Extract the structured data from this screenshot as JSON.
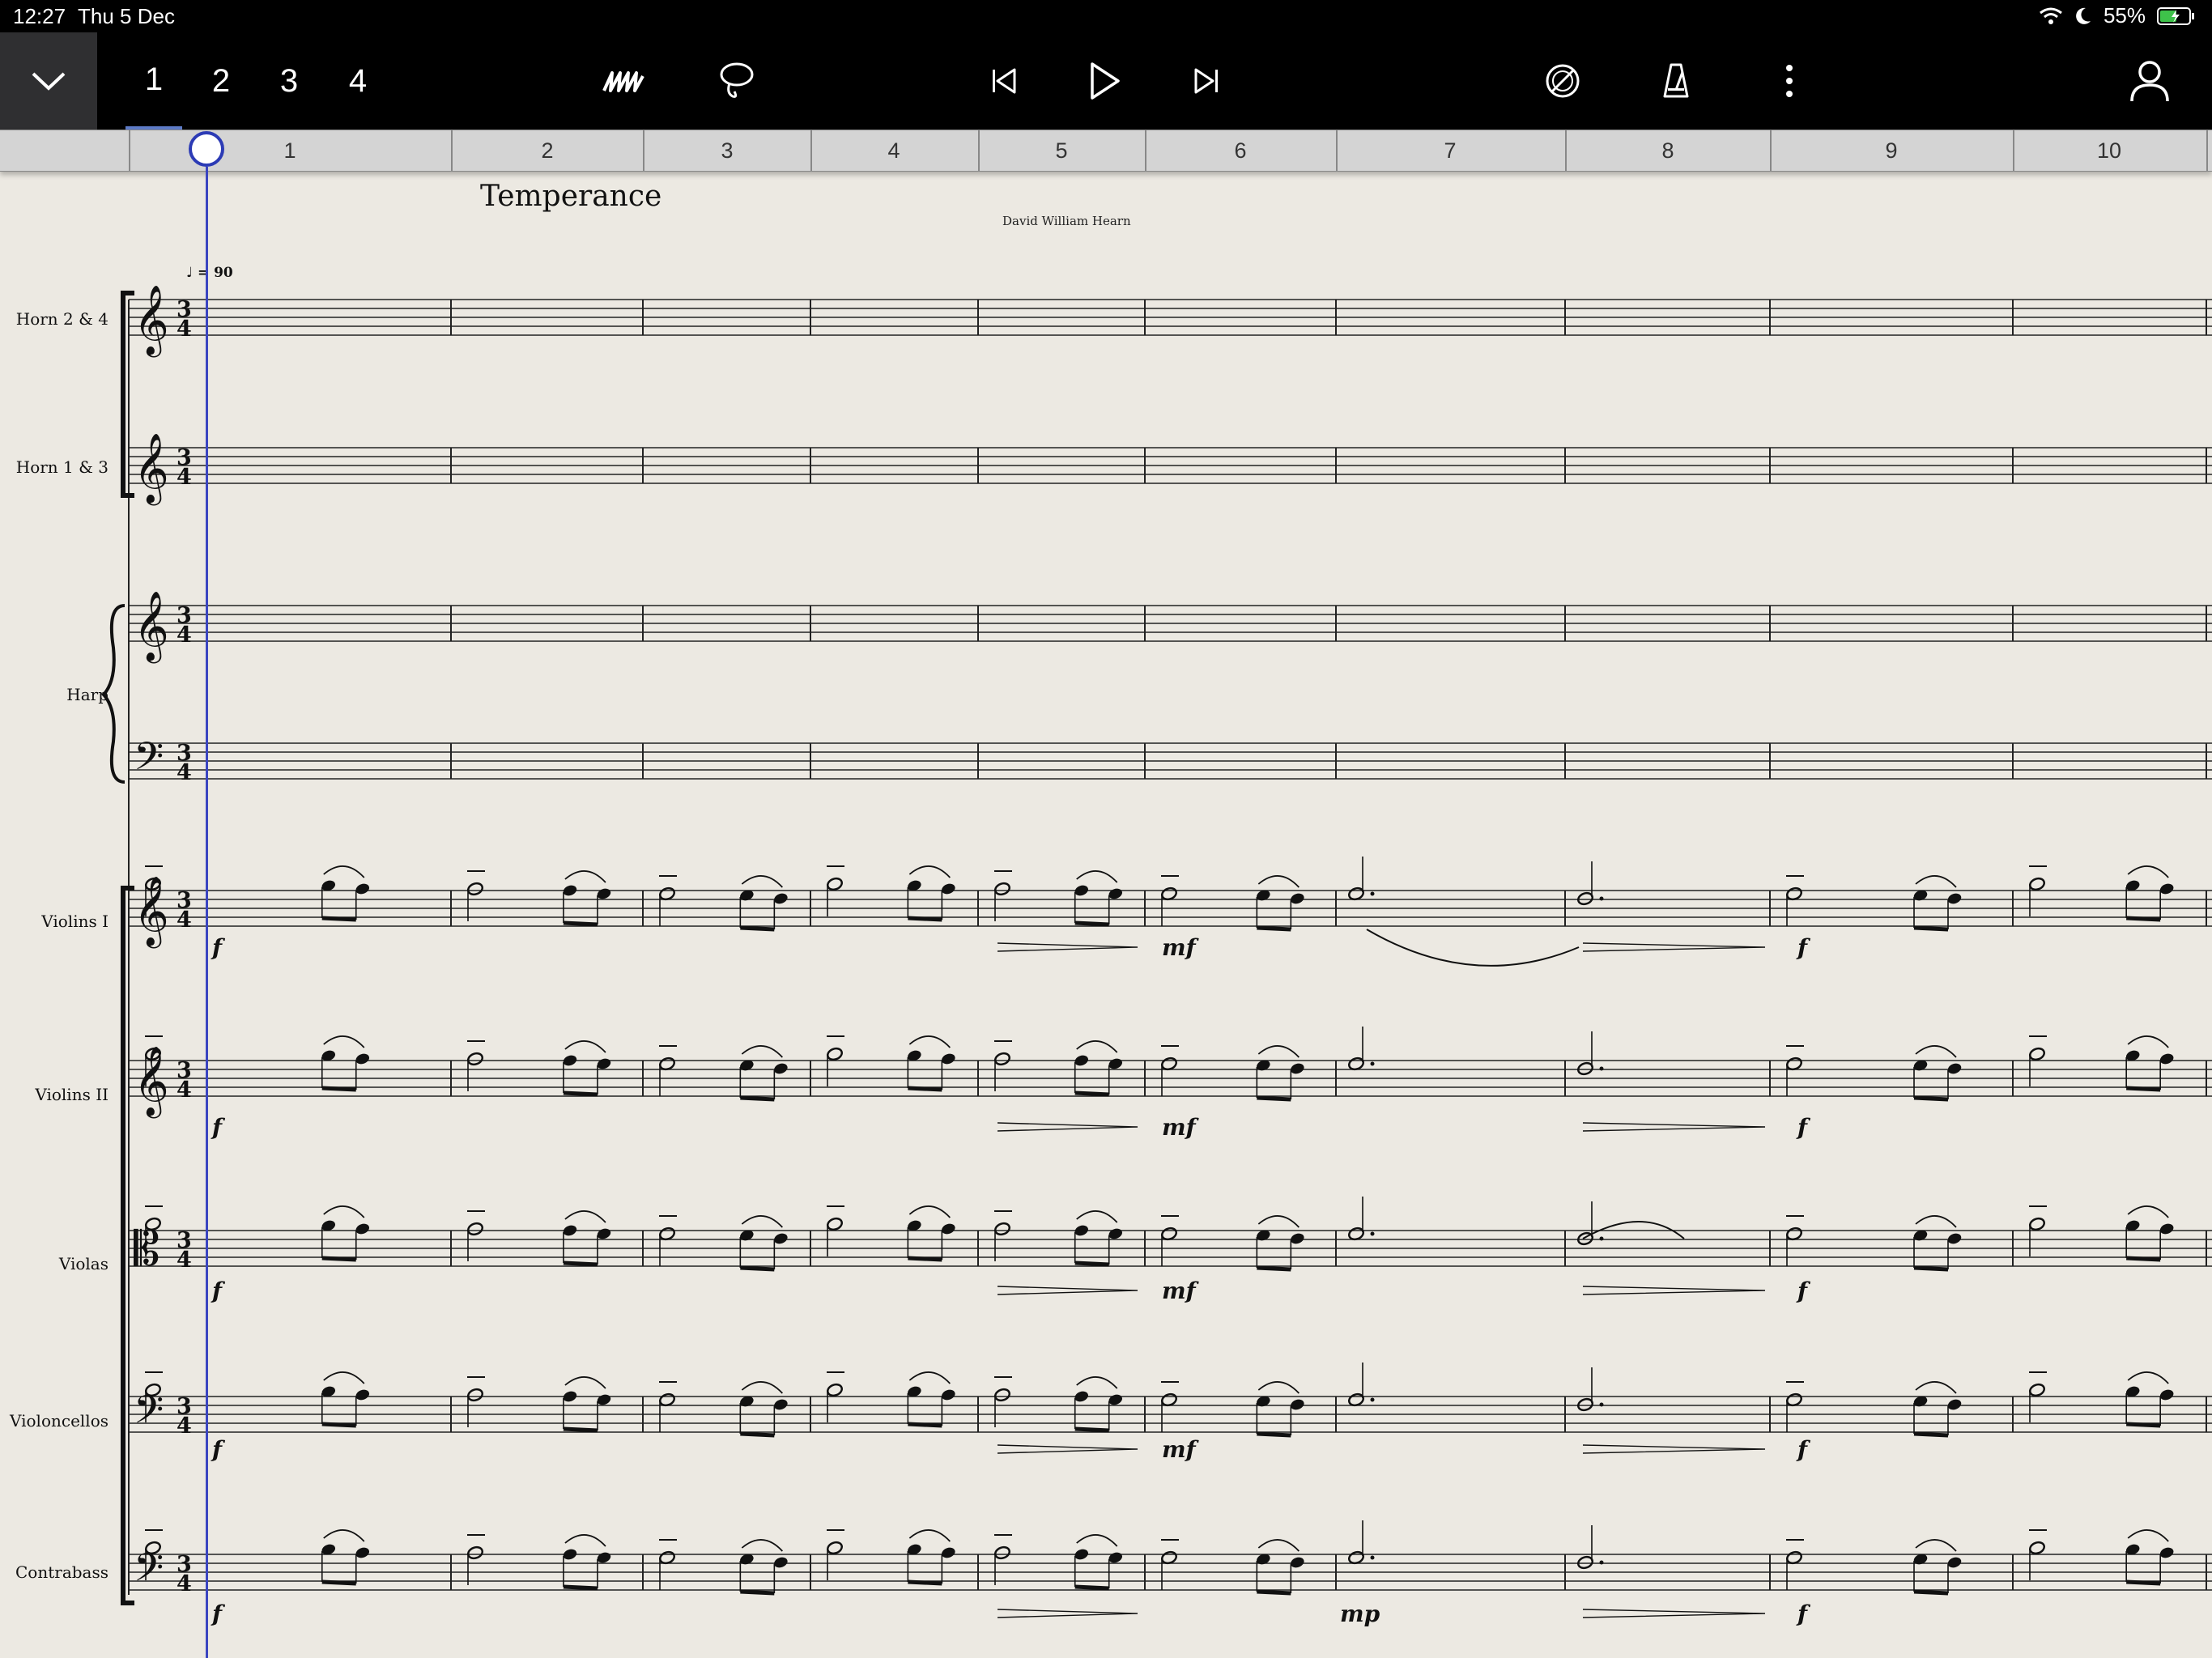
{
  "status_bar": {
    "time": "12:27",
    "date": "Thu 5 Dec",
    "battery": "55%",
    "icons": [
      "wifi-icon",
      "moon-icon",
      "battery-charging-icon"
    ]
  },
  "toolbar": {
    "collapse_icon": "chevron-down-icon",
    "page_tabs": [
      "1",
      "2",
      "3",
      "4"
    ],
    "active_page": "1",
    "tools": [
      "handwriting-icon",
      "lasso-icon",
      "skip-back-icon",
      "play-icon",
      "skip-forward-icon",
      "mixer-icon",
      "metronome-icon",
      "more-icon",
      "account-icon"
    ]
  },
  "ruler": {
    "bars": [
      "1",
      "2",
      "3",
      "4",
      "5",
      "6",
      "7",
      "8",
      "9",
      "10"
    ]
  },
  "score": {
    "title": "Temperance",
    "composer": "David William Hearn",
    "tempo": "= 90",
    "time_signature": "3/4",
    "instruments": [
      "Horn 2 & 4",
      "Horn 1 & 3",
      "Harp",
      "Violins I",
      "Violins II",
      "Violas",
      "Violoncellos",
      "Contrabass"
    ]
  },
  "colors": {
    "paper": "#ece9e2",
    "toolbar": "#000000",
    "playhead": "#3b45c0"
  }
}
